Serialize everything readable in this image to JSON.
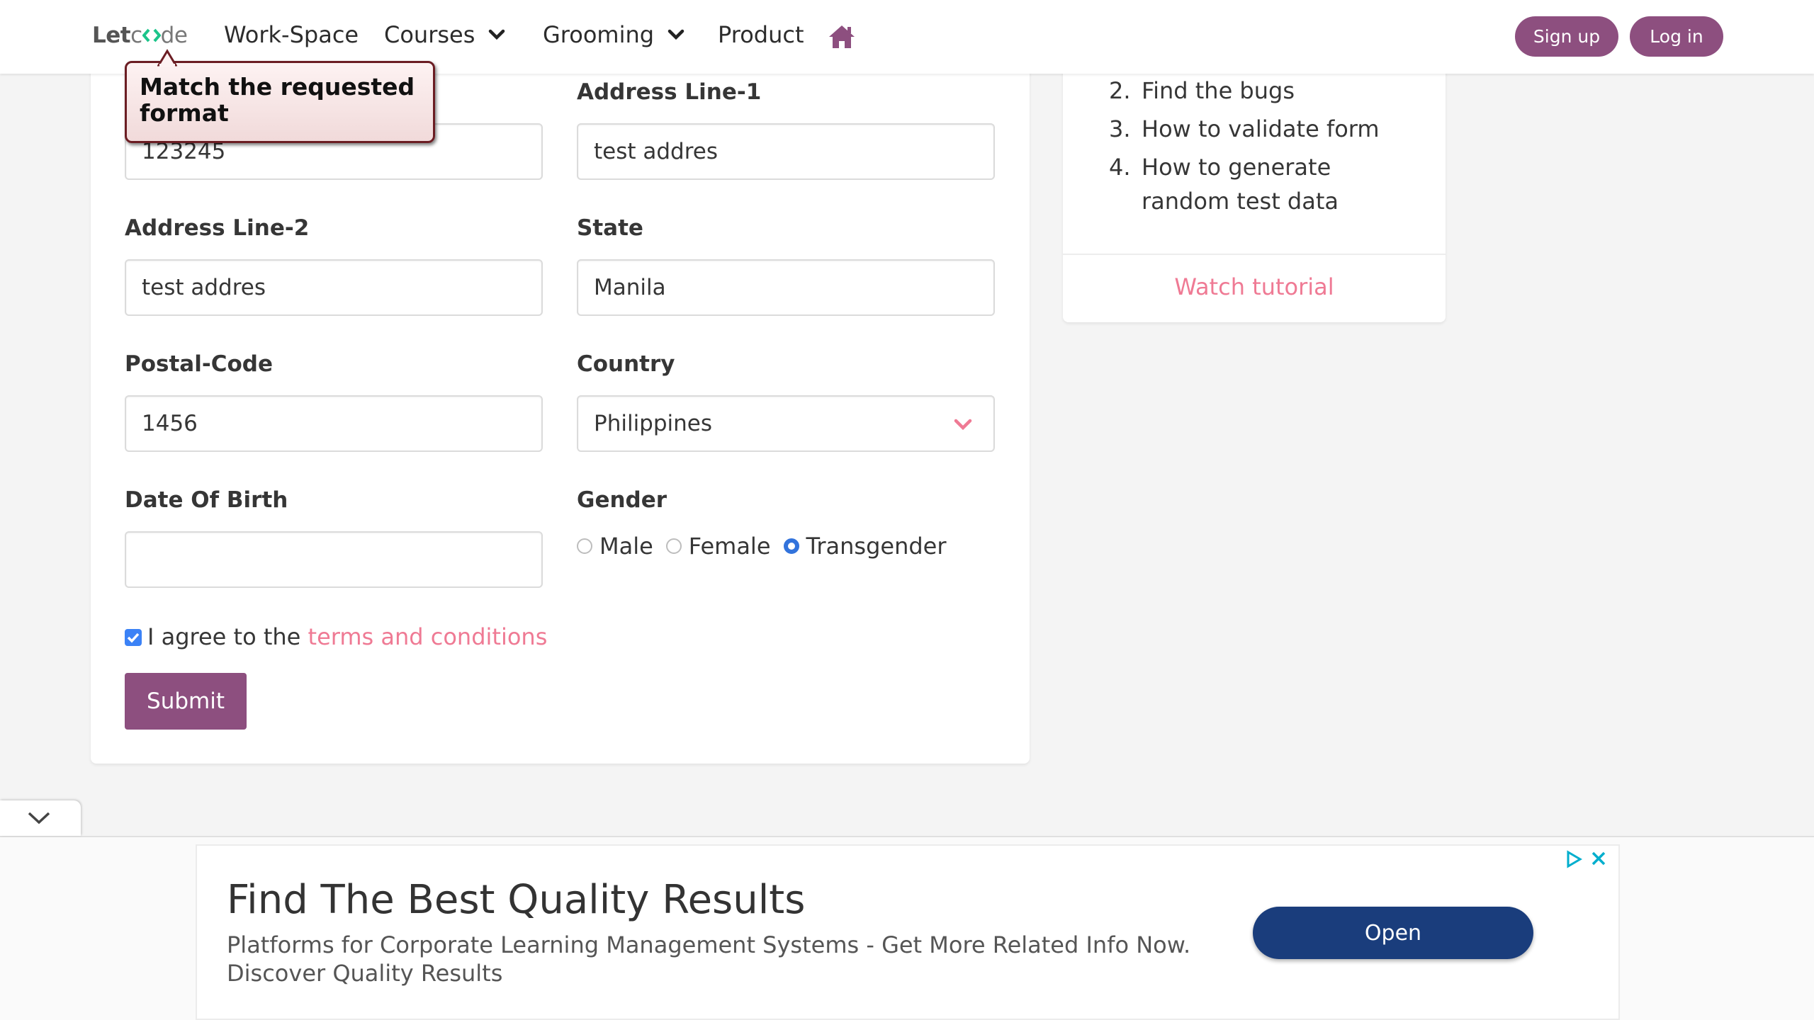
{
  "nav": {
    "logo_let": "Let",
    "logo_c": "c",
    "logo_de": "de",
    "items": [
      {
        "label": "Work-Space"
      },
      {
        "label": "Courses"
      },
      {
        "label": "Grooming"
      },
      {
        "label": "Product"
      }
    ],
    "signup": "Sign up",
    "login": "Log in"
  },
  "tooltip": {
    "message": "Match the requested format"
  },
  "form": {
    "partial_field": {
      "value": "123245"
    },
    "address1": {
      "label": "Address Line-1",
      "value": "test addres"
    },
    "address2": {
      "label": "Address Line-2",
      "value": "test addres"
    },
    "state": {
      "label": "State",
      "value": "Manila"
    },
    "postal": {
      "label": "Postal-Code",
      "value": "1456"
    },
    "country": {
      "label": "Country",
      "value": "Philippines"
    },
    "dob": {
      "label": "Date Of Birth",
      "value": ""
    },
    "gender": {
      "label": "Gender",
      "options": [
        "Male",
        "Female",
        "Transgender"
      ],
      "selected": "Transgender"
    },
    "agree_text": "I agree to the ",
    "agree_link": "terms and conditions",
    "agree_checked": true,
    "submit": "Submit"
  },
  "side": {
    "items": [
      {
        "num": "2.",
        "text": "Find the bugs"
      },
      {
        "num": "3.",
        "text": "How to validate form"
      },
      {
        "num": "4.",
        "text": "How to generate random test data"
      }
    ],
    "watch": "Watch tutorial"
  },
  "ad": {
    "title": "Find The Best Quality Results",
    "description": "Platforms for Corporate Learning Management Systems - Get More Related Info Now. Discover Quality Results",
    "button": "Open"
  },
  "colors": {
    "brand": "#8d4f7f",
    "link": "#ef7a94",
    "radio_checked": "#3273dc",
    "ad_button": "#1a3d7c"
  }
}
